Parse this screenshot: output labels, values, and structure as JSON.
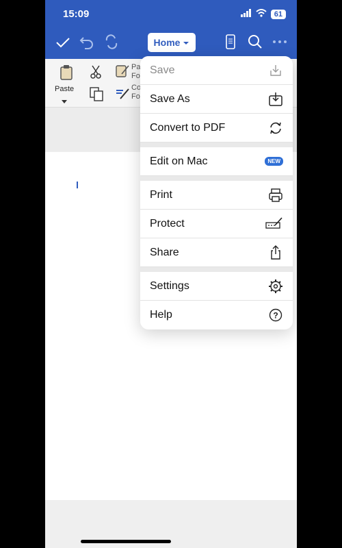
{
  "status": {
    "time": "15:09",
    "battery": "61"
  },
  "toolbar": {
    "home_label": "Home"
  },
  "ribbon": {
    "paste_label": "Paste",
    "paste_format_partial": "Pa Fo",
    "copy_format_partial": "Co Fo"
  },
  "menu": {
    "items": [
      {
        "label": "Save",
        "icon": "save-download-icon",
        "disabled": true
      },
      {
        "label": "Save As",
        "icon": "save-as-icon"
      },
      {
        "label": "Convert to PDF",
        "icon": "convert-sync-icon"
      },
      {
        "label": "Edit on Mac",
        "badge": "NEW"
      },
      {
        "label": "Print",
        "icon": "printer-icon"
      },
      {
        "label": "Protect",
        "icon": "signature-pen-icon"
      },
      {
        "label": "Share",
        "icon": "share-icon"
      },
      {
        "label": "Settings",
        "icon": "gear-icon"
      },
      {
        "label": "Help",
        "icon": "help-icon"
      }
    ]
  }
}
